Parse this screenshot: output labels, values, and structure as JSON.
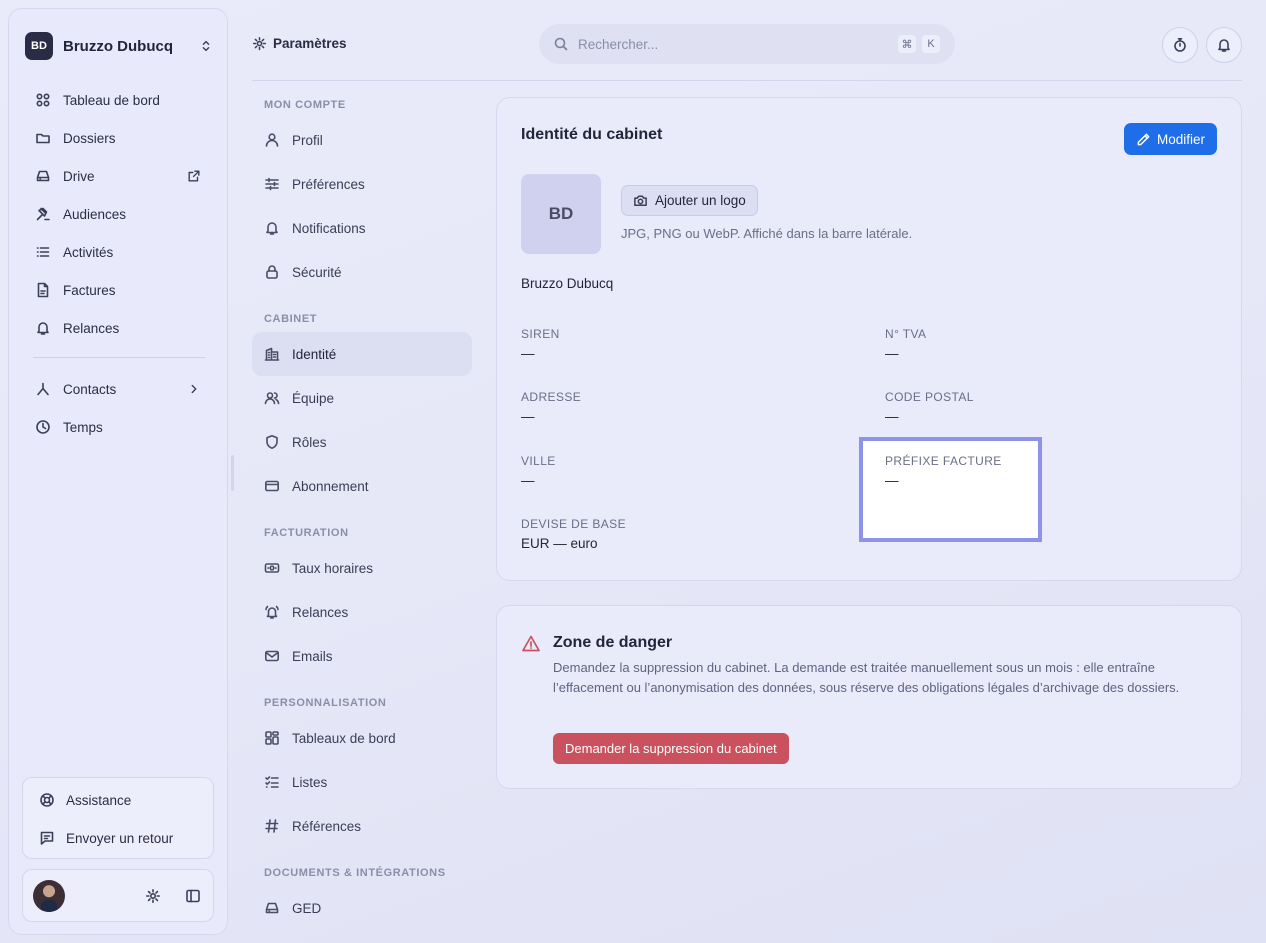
{
  "workspace": {
    "initials": "BD",
    "name": "Bruzzo Dubucq"
  },
  "sidebar": {
    "items": [
      {
        "label": "Tableau de bord",
        "icon": "dashboard-icon"
      },
      {
        "label": "Dossiers",
        "icon": "folder-icon"
      },
      {
        "label": "Drive",
        "icon": "drive-icon",
        "external": true
      },
      {
        "label": "Audiences",
        "icon": "gavel-icon"
      },
      {
        "label": "Activités",
        "icon": "list-icon"
      },
      {
        "label": "Factures",
        "icon": "invoice-icon"
      },
      {
        "label": "Relances",
        "icon": "bell-icon"
      }
    ],
    "secondary": [
      {
        "label": "Contacts",
        "icon": "contacts-icon",
        "has_children": true
      },
      {
        "label": "Temps",
        "icon": "clock-icon"
      }
    ],
    "help": [
      {
        "label": "Assistance",
        "icon": "lifebuoy-icon"
      },
      {
        "label": "Envoyer un retour",
        "icon": "feedback-icon"
      }
    ]
  },
  "topbar": {
    "title": "Paramètres",
    "search_placeholder": "Rechercher...",
    "shortcut_keys": [
      "⌘",
      "K"
    ]
  },
  "settings_nav": {
    "groups": [
      {
        "title": "MON COMPTE",
        "items": [
          {
            "label": "Profil",
            "icon": "user-icon"
          },
          {
            "label": "Préférences",
            "icon": "sliders-icon"
          },
          {
            "label": "Notifications",
            "icon": "bell-icon"
          },
          {
            "label": "Sécurité",
            "icon": "lock-icon"
          }
        ]
      },
      {
        "title": "CABINET",
        "items": [
          {
            "label": "Identité",
            "icon": "building-icon",
            "active": true
          },
          {
            "label": "Équipe",
            "icon": "users-icon"
          },
          {
            "label": "Rôles",
            "icon": "shield-icon"
          },
          {
            "label": "Abonnement",
            "icon": "credit-card-icon"
          }
        ]
      },
      {
        "title": "FACTURATION",
        "items": [
          {
            "label": "Taux horaires",
            "icon": "banknote-icon"
          },
          {
            "label": "Relances",
            "icon": "bell-ring-icon"
          },
          {
            "label": "Emails",
            "icon": "mail-icon"
          }
        ]
      },
      {
        "title": "PERSONNALISATION",
        "items": [
          {
            "label": "Tableaux de bord",
            "icon": "dashboard-icon"
          },
          {
            "label": "Listes",
            "icon": "checklist-icon"
          },
          {
            "label": "Références",
            "icon": "hash-icon"
          }
        ]
      },
      {
        "title": "DOCUMENTS & INTÉGRATIONS",
        "items": [
          {
            "label": "GED",
            "icon": "drive-icon"
          }
        ]
      }
    ]
  },
  "identity": {
    "title": "Identité du cabinet",
    "edit_label": "Modifier",
    "logo_initials": "BD",
    "add_logo_label": "Ajouter un logo",
    "logo_hint": "JPG, PNG ou WebP. Affiché dans la barre latérale.",
    "cabinet_name": "Bruzzo Dubucq",
    "fields": {
      "siren": {
        "label": "SIREN",
        "value": "—"
      },
      "tva": {
        "label": "N° TVA",
        "value": "—"
      },
      "adresse": {
        "label": "ADRESSE",
        "value": "—"
      },
      "code_postal": {
        "label": "CODE POSTAL",
        "value": "—"
      },
      "ville": {
        "label": "VILLE",
        "value": "—"
      },
      "prefixe": {
        "label": "PRÉFIXE FACTURE",
        "value": "—"
      },
      "devise": {
        "label": "DEVISE DE BASE",
        "value": "EUR — euro"
      }
    }
  },
  "danger": {
    "title": "Zone de danger",
    "text": "Demandez la suppression du cabinet. La demande est traitée manuellement sous un mois : elle entraîne l’effacement ou l’anonymisation des données, sous réserve des obligations légales d’archivage des dossiers.",
    "button_label": "Demander la suppression du cabinet"
  },
  "colors": {
    "primary": "#1d6ee8",
    "danger": "#c9525e",
    "highlight_border": "#8d93e8"
  }
}
